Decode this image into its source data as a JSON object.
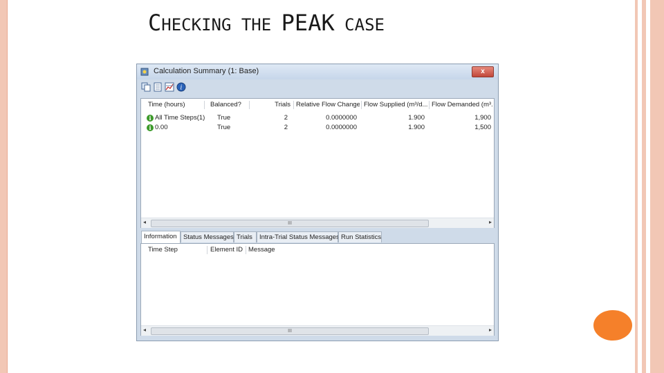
{
  "slide": {
    "title_cap1": "C",
    "title_rest1": "HECKING THE ",
    "title_big": "PEAK",
    "title_rest2": " CASE"
  },
  "window": {
    "title": "Calculation Summary (1: Base)",
    "close_label": "x"
  },
  "toolbar": {
    "icons": [
      "copy-icon",
      "report-icon",
      "chart-icon",
      "help-icon"
    ]
  },
  "results": {
    "columns": [
      "Time (hours)",
      "Balanced?",
      "Trials",
      "Relative Flow Change",
      "Flow Supplied (m³/d...",
      "Flow Demanded (m³..."
    ],
    "rows": [
      {
        "time": "All Time Steps(1)",
        "balanced": "True",
        "trials": "2",
        "rel_flow_change": "0.0000000",
        "flow_supplied": "1.900",
        "flow_demanded": "1,900"
      },
      {
        "time": "0.00",
        "balanced": "True",
        "trials": "2",
        "rel_flow_change": "0.0000000",
        "flow_supplied": "1.900",
        "flow_demanded": "1,500"
      }
    ],
    "scroll_thumb": "III"
  },
  "tabs": [
    "Information",
    "Status Messages",
    "Trials",
    "Intra-Trial Status Messages",
    "Run Statistics"
  ],
  "messages": {
    "columns": [
      "Time Step",
      "Element ID",
      "Message"
    ],
    "scroll_thumb": "III"
  }
}
